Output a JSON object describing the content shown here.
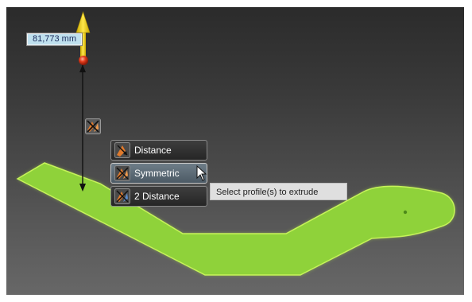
{
  "dimension": {
    "value": "81,773 mm"
  },
  "extrude_menu": {
    "items": [
      {
        "label": "Distance",
        "icon": "extrude-distance-icon"
      },
      {
        "label": "Symmetric",
        "icon": "extrude-symmetric-icon"
      },
      {
        "label": "2 Distance",
        "icon": "extrude-two-distance-icon"
      }
    ],
    "active_index": 1
  },
  "tooltip": {
    "text": "Select profile(s) to extrude"
  },
  "colors": {
    "profile_fill": "#8fd23a",
    "profile_glow": "#b7f04a",
    "arrow_yellow": "#f2d21a",
    "handle_red": "#e23a1a",
    "icon_orange": "#e07a2c"
  }
}
